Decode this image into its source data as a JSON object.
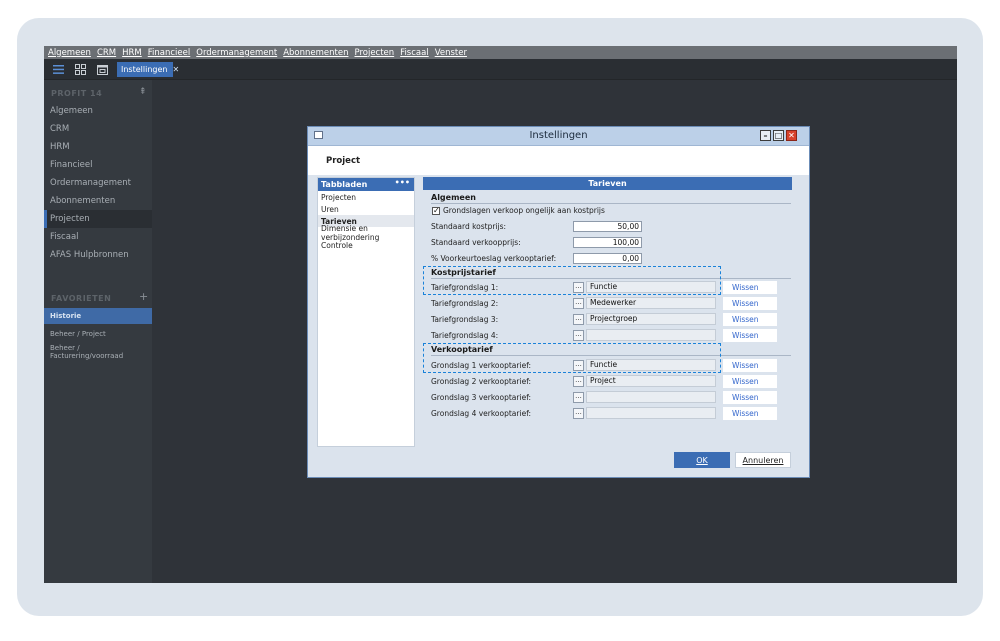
{
  "menu": [
    "Algemeen",
    "CRM",
    "HRM",
    "Financieel",
    "Ordermanagement",
    "Abonnementen",
    "Projecten",
    "Fiscaal",
    "Venster"
  ],
  "toolbar": {
    "icons": [
      "hamburger-icon",
      "grid-icon",
      "calendar-icon"
    ],
    "open_tab": "Instellingen"
  },
  "sidebar": {
    "heading": "PROFIT 14",
    "pin_glyph": "⇞",
    "items": [
      "Algemeen",
      "CRM",
      "HRM",
      "Financieel",
      "Ordermanagement",
      "Abonnementen",
      "Projecten",
      "Fiscaal",
      "AFAS Hulpbronnen"
    ],
    "active_item": "Projecten",
    "favorites_heading": "FAVORIETEN",
    "favorites_add": "+",
    "favorites": [
      "Historie",
      "Beheer / Project",
      "Beheer / Facturering/voorraad"
    ]
  },
  "dialog": {
    "title": "Instellingen",
    "header": "Project",
    "left_panel": {
      "heading": "Tabbladen",
      "menu_glyph": "•••",
      "items": [
        "Projecten",
        "Uren",
        "Tarieven",
        "Dimensie en verbijzondering",
        "Controle"
      ],
      "selected": "Tarieven"
    },
    "right_panel": {
      "heading": "Tarieven",
      "algemeen": {
        "title": "Algemeen",
        "checkbox_label": "Grondslagen verkoop ongelijk aan kostprijs",
        "checkbox_checked": true,
        "rows": [
          {
            "label": "Standaard kostprijs:",
            "value": "50,00"
          },
          {
            "label": "Standaard verkoopprijs:",
            "value": "100,00"
          },
          {
            "label": "% Voorkeurtoeslag verkooptarief:",
            "value": "0,00"
          }
        ]
      },
      "kostprijstarief": {
        "title": "Kostprijstarief",
        "rows": [
          {
            "label": "Tariefgrondslag 1:",
            "value": "Functie"
          },
          {
            "label": "Tariefgrondslag 2:",
            "value": "Medewerker"
          },
          {
            "label": "Tariefgrondslag 3:",
            "value": "Projectgroep"
          },
          {
            "label": "Tariefgrondslag 4:",
            "value": ""
          }
        ]
      },
      "verkooptarief": {
        "title": "Verkooptarief",
        "rows": [
          {
            "label": "Grondslag 1 verkooptarief:",
            "value": "Functie"
          },
          {
            "label": "Grondslag 2 verkooptarief:",
            "value": "Project"
          },
          {
            "label": "Grondslag 3 verkooptarief:",
            "value": ""
          },
          {
            "label": "Grondslag 4 verkooptarief:",
            "value": ""
          }
        ]
      },
      "lookup_glyph": "...",
      "clear_label": "Wissen"
    },
    "ok_label": "OK",
    "cancel_label": "Annuleren"
  },
  "colors": {
    "accent": "#3b6db4",
    "highlight": "#1a82d9",
    "link": "#3366cc"
  }
}
